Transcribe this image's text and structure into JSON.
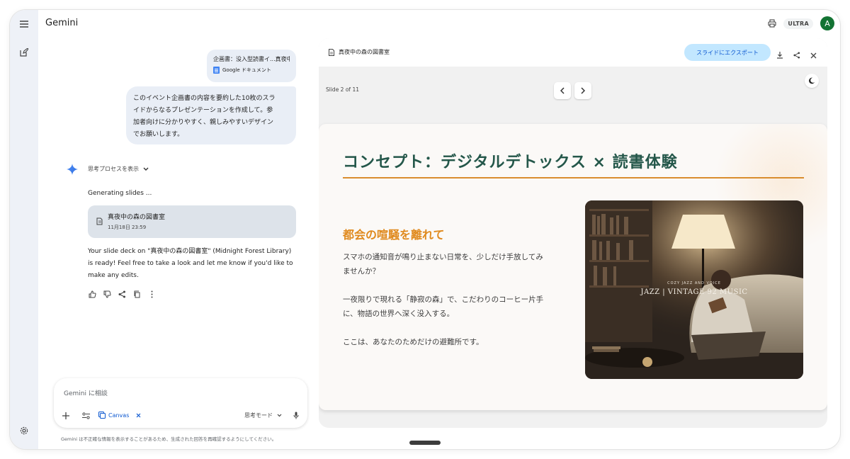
{
  "header": {
    "app_title": "Gemini",
    "plan_badge": "ULTRA",
    "avatar_initial": "A"
  },
  "rail": {
    "icons": [
      "menu-icon",
      "new-chat-icon",
      "settings-icon"
    ]
  },
  "chat": {
    "attachment": {
      "title": "企画書：没入型読書イ...真夜中",
      "type_label": "Google ドキュメント"
    },
    "prompt_lines": [
      "このイベント企画書の内容を要約した10枚のスラ",
      "イドからなるプレゼンテーションを作成して。参",
      "加者向けに分かりやすく、親しみやすいデザイン",
      "でお願いします。"
    ],
    "show_thinking": "思考プロセスを表示",
    "generating": "Generating slides ...",
    "file_card": {
      "name": "真夜中の森の図書室",
      "date": "11月18日 23:59"
    },
    "response_lines": [
      "Your slide deck on \"真夜中の森の図書室\" (Midnight Forest Library)",
      "is ready! Feel free to take a look and let me know if you'd like to",
      "make any edits."
    ]
  },
  "input": {
    "placeholder": "Gemini に相談",
    "canvas_chip": "Canvas",
    "mode_label": "思考モード"
  },
  "disclaimer": "Gemini は不正確な情報を表示することがあるため、生成された回答を再確認するようにしてください。",
  "panel": {
    "title": "真夜中の森の図書室",
    "export_label": "スライドにエクスポート",
    "slide_counter": "Slide 2 of 11"
  },
  "slide": {
    "title": "コンセプト：デジタルデトックス × 読書体験",
    "subtitle": "都会の喧騒を離れて",
    "paragraphs": [
      [
        "スマホの通知音が鳴り止まない日常を、少しだけ手放してみ",
        "ませんか？"
      ],
      [
        "一夜限りで現れる「静寂の森」で、こだわりのコーヒー片手",
        "に、物語の世界へ深く没入する。"
      ],
      [
        "ここは、あなたのためだけの避難所です。"
      ]
    ],
    "photo_caption_small": "COZY JAZZ AND VOICE",
    "photo_caption": "JAZZ | VINTAGE 92  MUSIC"
  },
  "colors": {
    "title_green": "#24574a",
    "accent_orange": "#e08a1e",
    "export_bg": "#c2e7ff",
    "export_text": "#0b57d0",
    "bubble_bg": "#e9eef6",
    "avatar_bg": "#137333"
  }
}
